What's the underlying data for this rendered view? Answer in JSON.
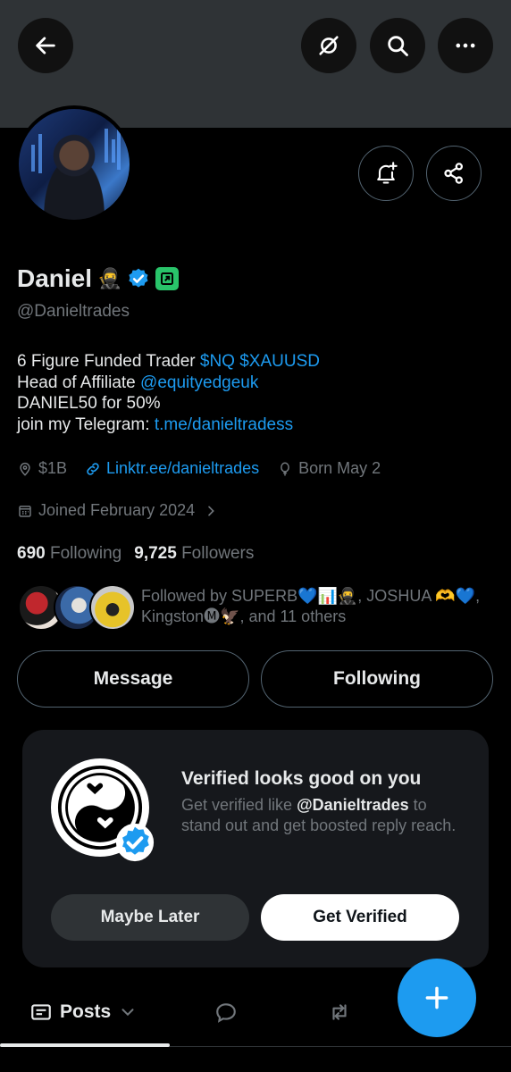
{
  "icons": {
    "back": "arrow-left-icon",
    "no_audio": "slash-circle-icon",
    "search": "search-icon",
    "more": "more-horizontal-icon",
    "notify": "bell-plus-icon",
    "share": "share-icon"
  },
  "colors": {
    "accent": "#1d9bf0",
    "verified": "#1d9bf0",
    "affiliate": "#29c46a",
    "muted": "#71767b"
  },
  "profile": {
    "name": "Daniel",
    "name_emoji": "🥷",
    "handle": "@Danieltrades",
    "bio": {
      "line1_text": "6 Figure Funded Trader ",
      "line1_link": "$NQ $XAUUSD",
      "line2_text": "Head of Affiliate ",
      "line2_link": "@equityedgeuk",
      "line3": "DANIEL50 for 50%",
      "line4_text": "join my Telegram: ",
      "line4_link": "t.me/danieltradess"
    },
    "location": "$1B",
    "website": "Linktr.ee/danieltrades",
    "birthday": "Born May 2",
    "joined": "Joined February 2024",
    "following_count": "690",
    "following_label": "Following",
    "followers_count": "9,725",
    "followers_label": "Followers",
    "followed_by": "Followed by SUPERB💙📊🥷, JOSHUA 🫶💙, Kingston🅜🦅, and 11 others"
  },
  "actions": {
    "message": "Message",
    "following": "Following"
  },
  "verify_card": {
    "title": "Verified looks good on you",
    "desc_prefix": "Get verified like ",
    "desc_handle": "@Danieltrades",
    "desc_suffix": " to stand out and get boosted reply reach.",
    "maybe_later": "Maybe Later",
    "get_verified": "Get Verified"
  },
  "tabs": {
    "posts": "Posts"
  }
}
